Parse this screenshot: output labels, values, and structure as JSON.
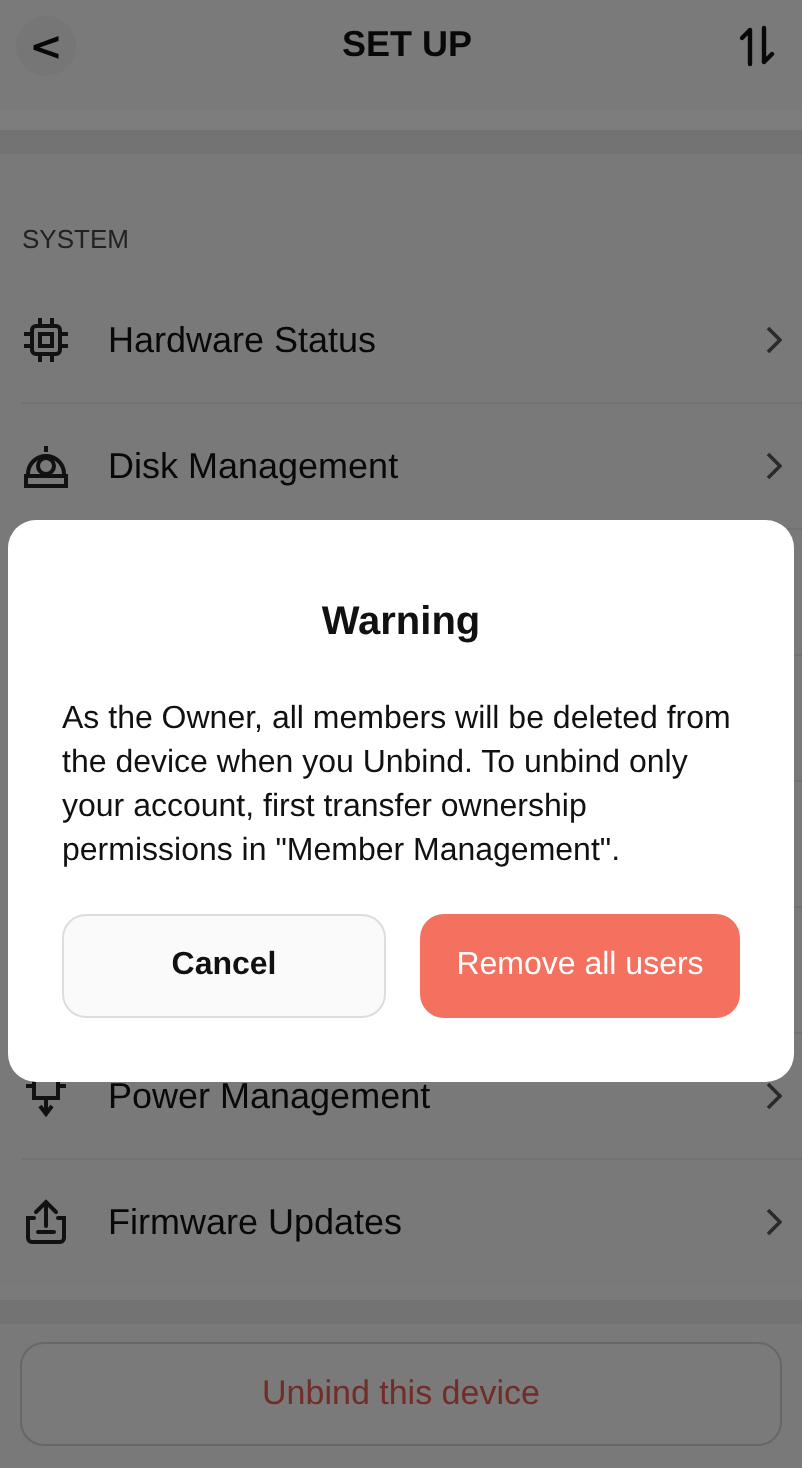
{
  "header": {
    "back": "<",
    "title": "SET UP"
  },
  "section": {
    "title": "SYSTEM"
  },
  "items_top": [
    {
      "label": "Hardware Status"
    },
    {
      "label": "Disk Management"
    }
  ],
  "items_bottom": [
    {
      "label": "Power Management"
    },
    {
      "label": "Firmware Updates"
    }
  ],
  "footer_button": "Unbind this device",
  "dialog": {
    "title": "Warning",
    "message": "As the Owner, all members will be deleted from the device when you Unbind. To unbind only your account, first transfer ownership permissions in \"Member Management\".",
    "buttons": [
      {
        "label": "Cancel",
        "kind": "secondary"
      },
      {
        "label": "Remove all users",
        "kind": "primary"
      }
    ]
  }
}
